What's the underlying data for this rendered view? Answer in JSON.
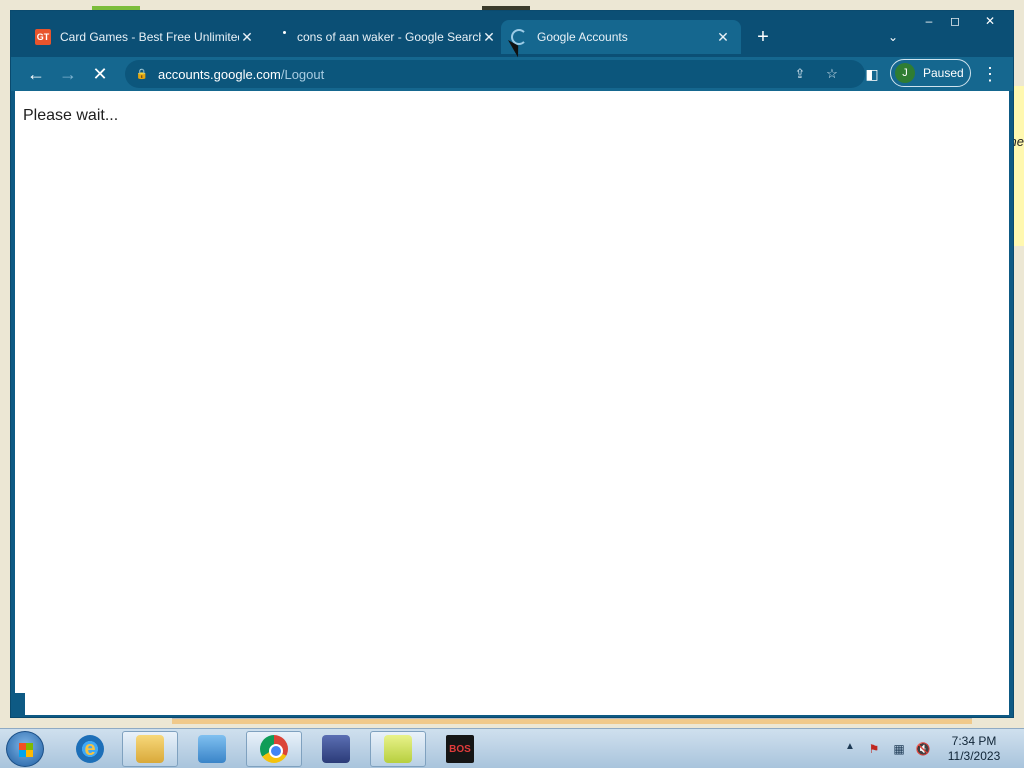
{
  "browser": {
    "tabs": [
      {
        "favicon": "GT",
        "title": "Card Games - Best Free Unlimited"
      },
      {
        "title": "cons of aan waker - Google Search"
      },
      {
        "title": "Google Accounts"
      }
    ],
    "url_host": "accounts.google.com",
    "url_path": "/Logout",
    "profile_initial": "J",
    "profile_label": "Paused"
  },
  "page": {
    "body_text": "Please wait..."
  },
  "desktop": {
    "note_text": "ne"
  },
  "taskbar": {
    "ie_glyph": "e",
    "bos_label": "BOS",
    "clock_time": "7:34 PM",
    "clock_date": "11/3/2023"
  }
}
